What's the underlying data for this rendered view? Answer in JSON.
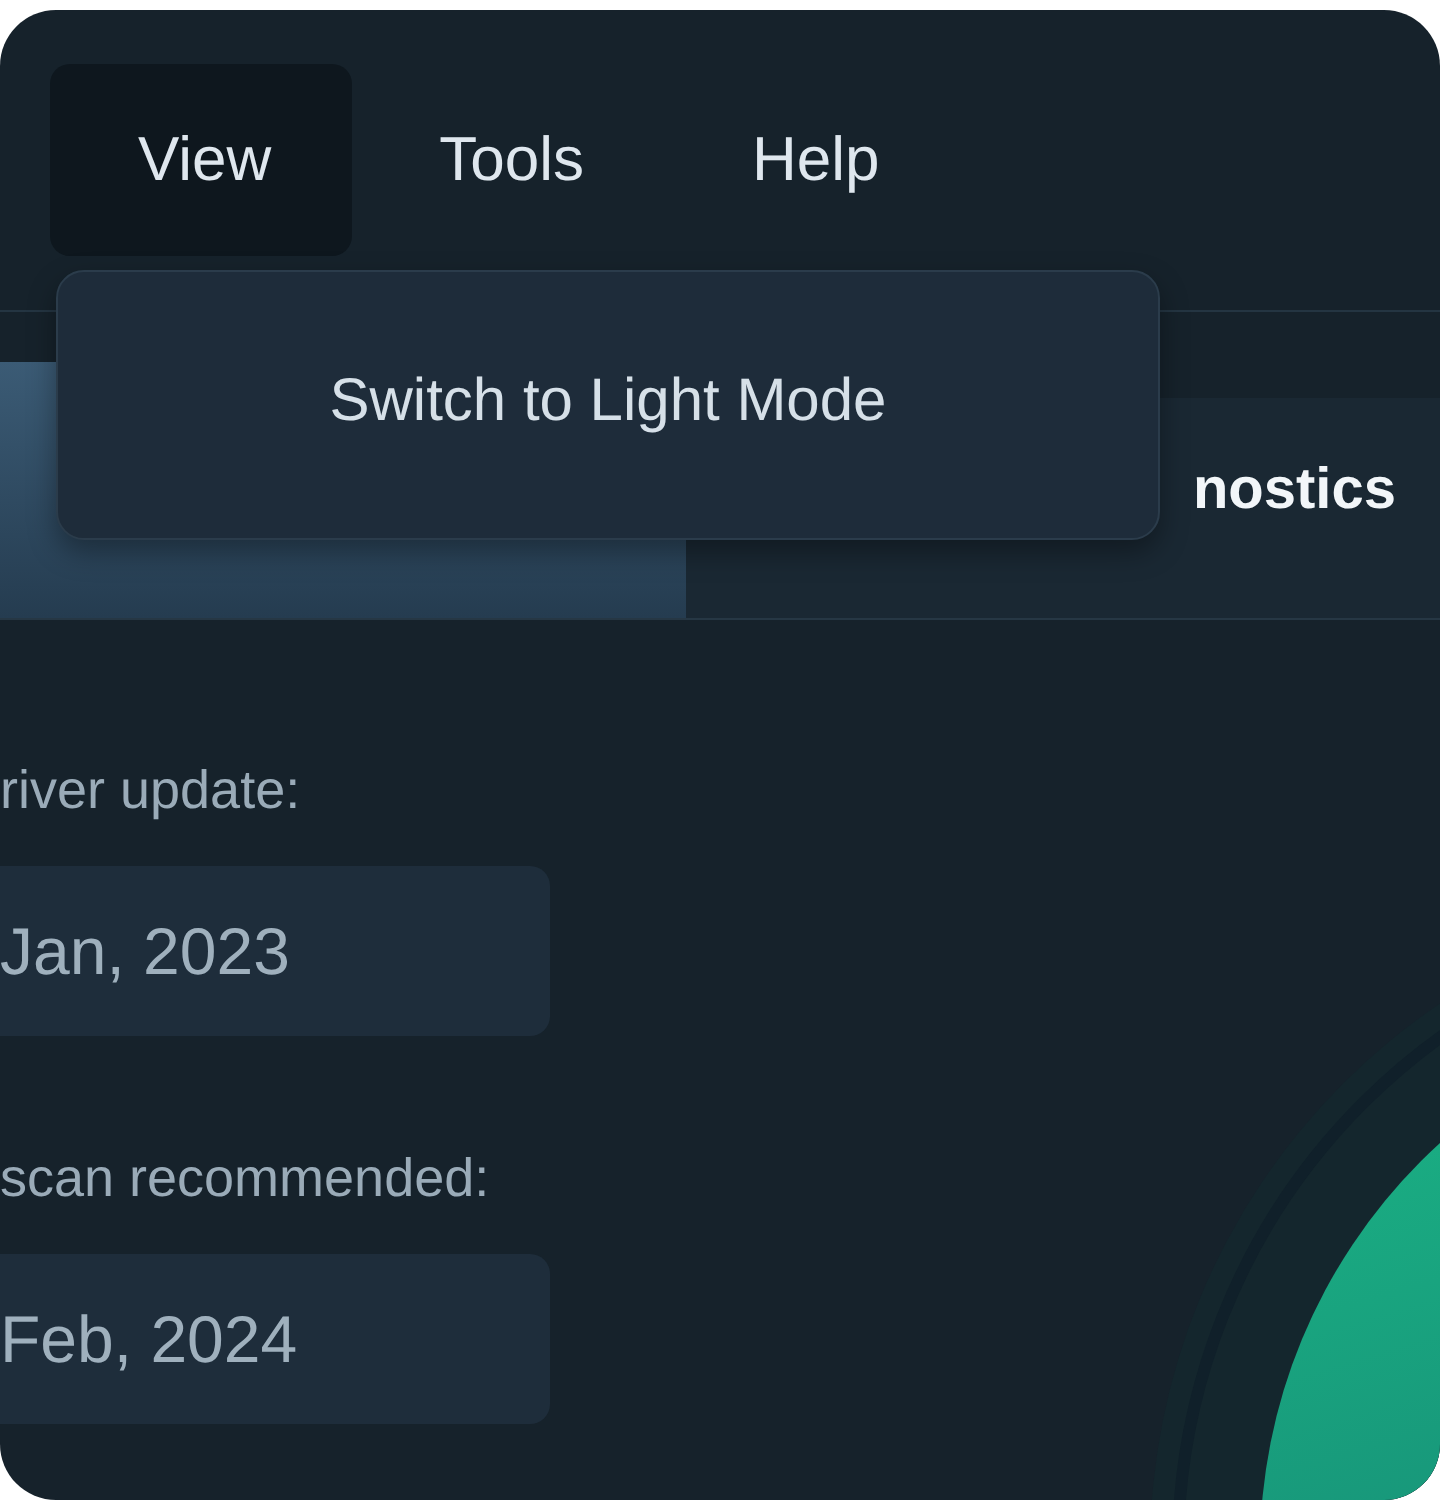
{
  "menu": [
    {
      "label": "View",
      "selected": true
    },
    {
      "label": "Tools",
      "selected": false
    },
    {
      "label": "Help",
      "selected": false
    }
  ],
  "dropdown": {
    "items": [
      "Switch to Light Mode"
    ]
  },
  "tabs": [
    {
      "selected": true
    },
    {
      "label": "nostics",
      "selected": false
    }
  ],
  "fields": [
    {
      "label": "river update:",
      "value": "Jan, 2023"
    },
    {
      "label": "scan recommended:",
      "value": "Feb, 2024"
    }
  ]
}
